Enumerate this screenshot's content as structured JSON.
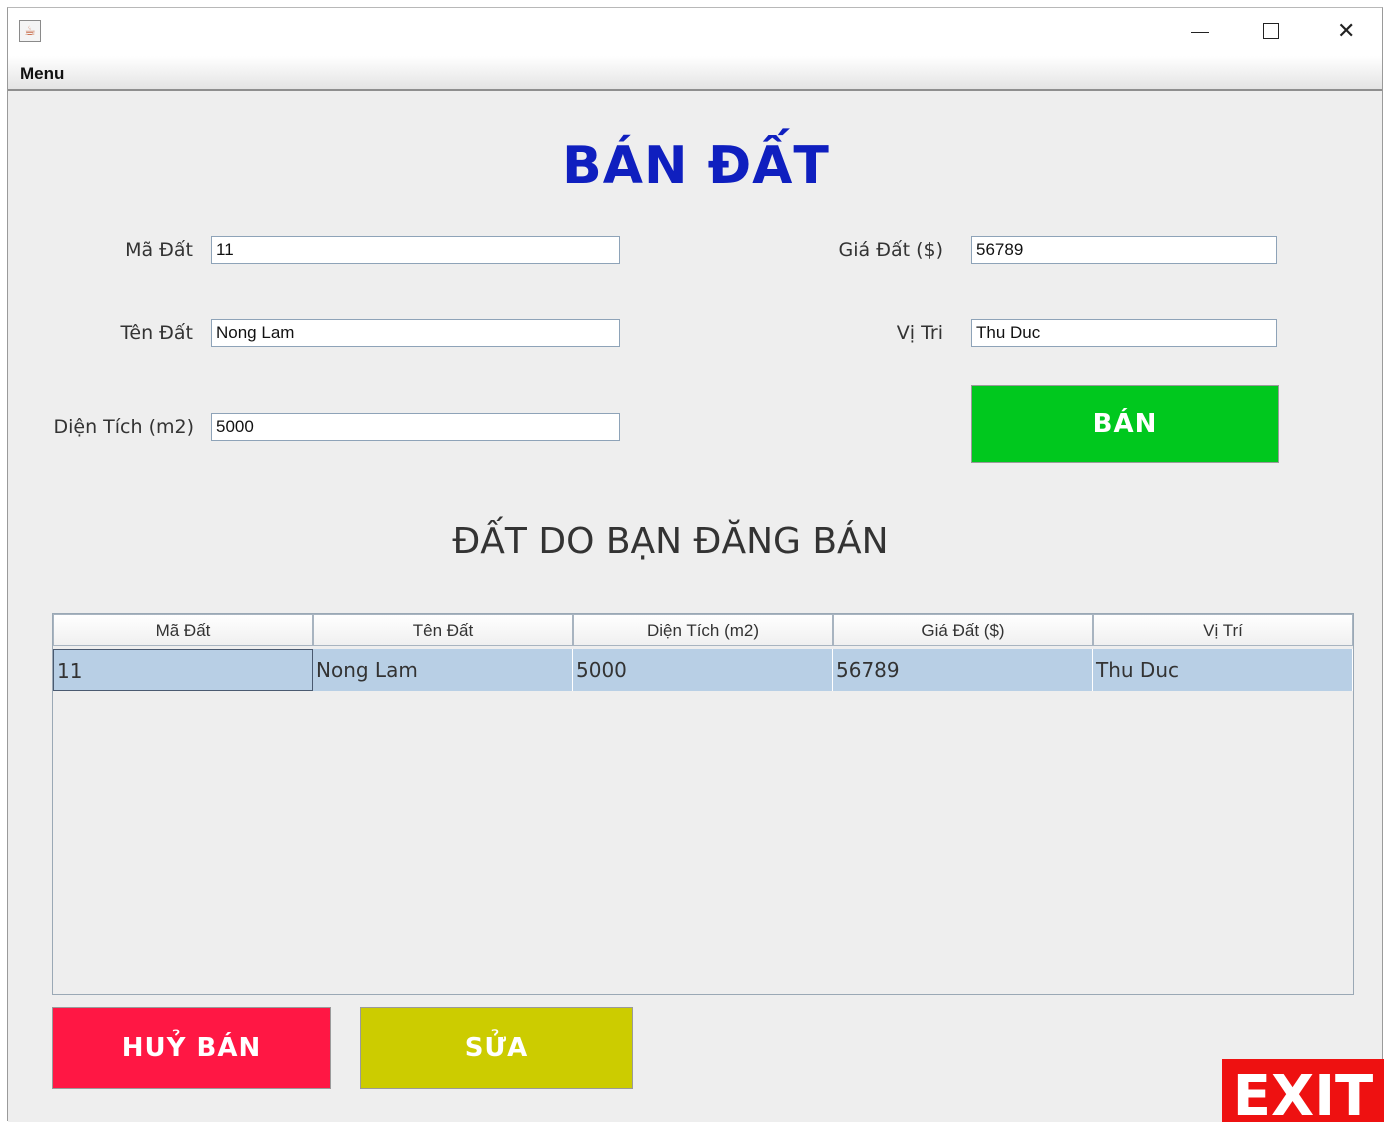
{
  "window": {
    "menu_label": "Menu",
    "icons": {
      "app": "java-icon",
      "minimize": "minimize-icon",
      "maximize": "maximize-icon",
      "close": "close-icon"
    }
  },
  "form": {
    "title": "BÁN ĐẤT",
    "ma_dat": {
      "label": "Mã Đất",
      "value": "11"
    },
    "ten_dat": {
      "label": "Tên Đất",
      "value": "Nong Lam"
    },
    "dien_tich": {
      "label": "Diện Tích (m2)",
      "value": "5000"
    },
    "gia_dat": {
      "label": "Giá Đất ($)",
      "value": "56789"
    },
    "vi_tri": {
      "label": "Vị Tri",
      "value": "Thu Duc"
    },
    "sell_button": "BÁN"
  },
  "table": {
    "title": "ĐẤT DO BẠN ĐĂNG BÁN",
    "columns": [
      "Mã Đất",
      "Tên Đất",
      "Diện Tích (m2)",
      "Giá Đất ($)",
      "Vị Trí"
    ],
    "rows": [
      [
        "11",
        "Nong Lam",
        "5000",
        "56789",
        "Thu Duc"
      ]
    ]
  },
  "actions": {
    "cancel_sale": "HUỶ BÁN",
    "edit": "SỬA",
    "exit": "EXIT"
  },
  "colors": {
    "title": "#0f1fbf",
    "sell": "#00c81e",
    "cancel": "#ff1744",
    "edit": "#cccc00",
    "exit": "#ee1111",
    "selected_row": "#b8cfe5"
  }
}
